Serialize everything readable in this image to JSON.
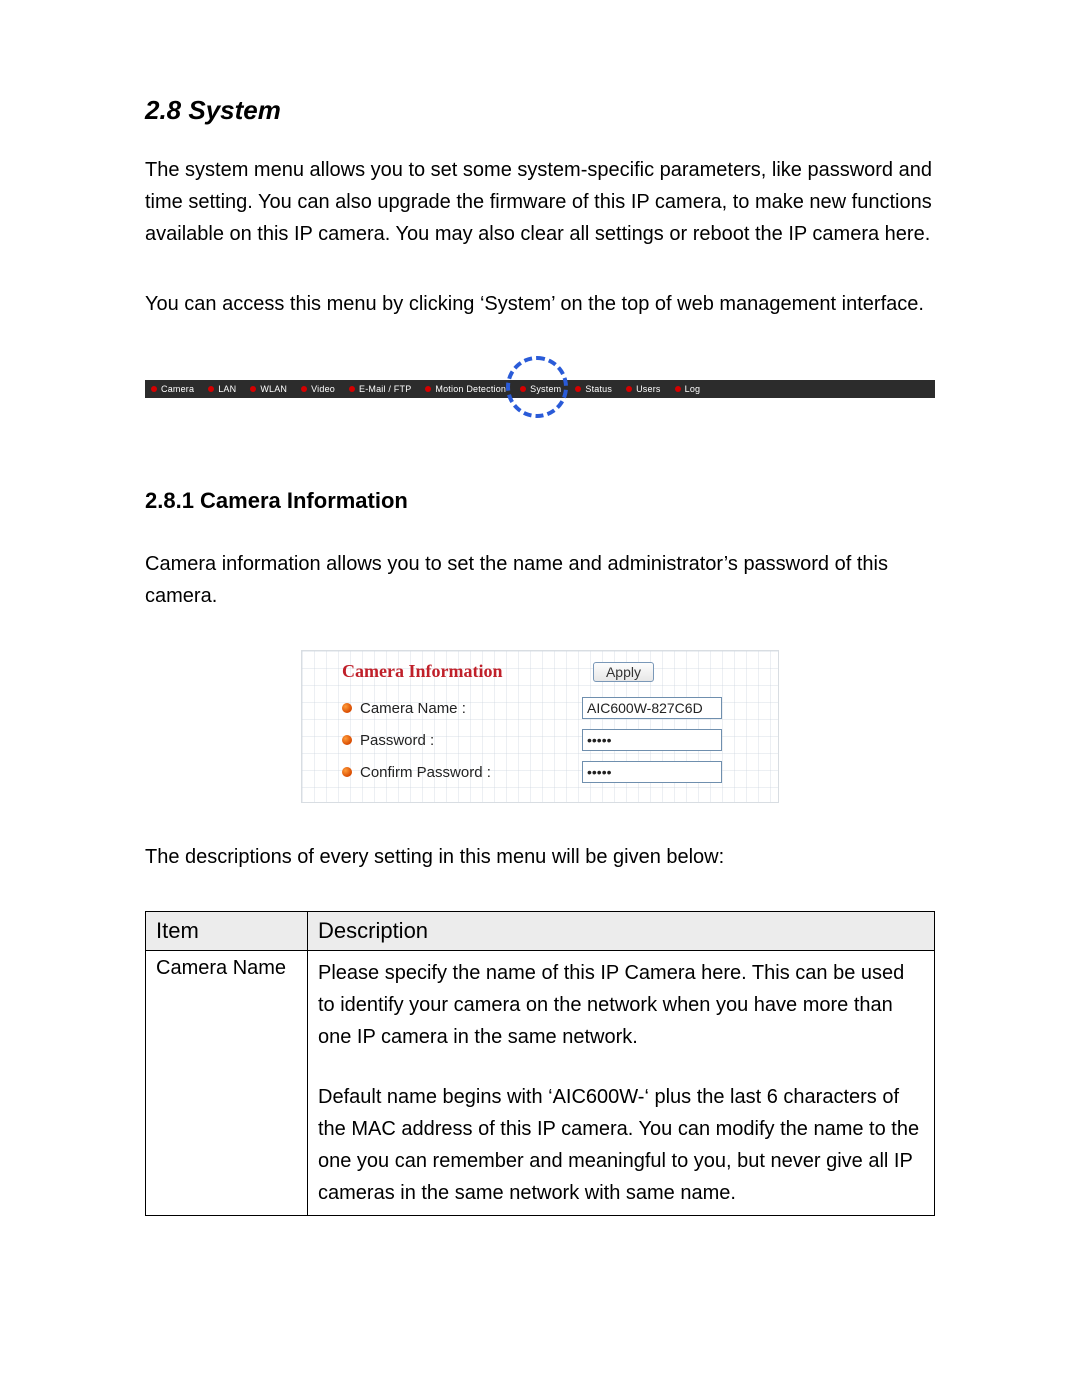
{
  "section": {
    "heading": "2.8 System",
    "para1": "The system menu allows you to set some system-specific parameters, like password and time setting. You can also upgrade the firmware of this IP camera, to make new functions available on this IP camera. You may also clear all settings or reboot the IP camera here.",
    "para2": "You can access this menu by clicking ‘System’ on the top of web management interface."
  },
  "nav": {
    "items": [
      "Camera",
      "LAN",
      "WLAN",
      "Video",
      "E-Mail / FTP",
      "Motion Detection",
      "System",
      "Status",
      "Users",
      "Log"
    ],
    "highlighted": "System"
  },
  "subsection": {
    "heading": "2.8.1 Camera Information",
    "para": "Camera information allows you to set the name and administrator’s password of this camera."
  },
  "form": {
    "title": "Camera Information",
    "apply_label": "Apply",
    "rows": [
      {
        "label": "Camera Name :",
        "value": "AIC600W-827C6D",
        "type": "text"
      },
      {
        "label": "Password :",
        "value": "•••••",
        "type": "password"
      },
      {
        "label": "Confirm Password :",
        "value": "•••••",
        "type": "password"
      }
    ]
  },
  "table_intro": "The descriptions of every setting in this menu will be given below:",
  "table": {
    "headers": [
      "Item",
      "Description"
    ],
    "rows": [
      {
        "item": "Camera Name",
        "desc1": "Please specify the name of this IP Camera here. This can be used to identify your camera on the network when you have more than one IP camera in the same network.",
        "desc2": "Default name begins with ‘AIC600W-‘ plus the last 6 characters of the MAC address of this IP camera. You can modify the name to the one you can remember and meaningful to you, but never give all IP cameras in the same network with same name."
      }
    ]
  }
}
